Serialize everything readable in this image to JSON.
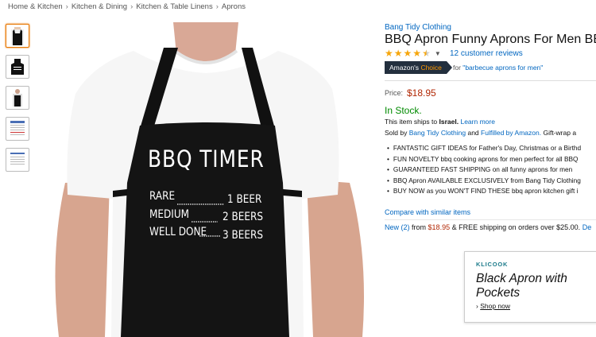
{
  "breadcrumb": {
    "items": [
      "Home & Kitchen",
      "Kitchen & Dining",
      "Kitchen & Table Linens",
      "Aprons"
    ],
    "separator": "›"
  },
  "thumbnails": [
    "apron-front",
    "apron-flat",
    "man-wearing-apron",
    "size-chart",
    "size-chart-2"
  ],
  "apron": {
    "title": "BBQ TIMER",
    "rows": [
      {
        "left": "RARE",
        "right": "1 BEER"
      },
      {
        "left": "MEDIUM",
        "right": "2 BEERS"
      },
      {
        "left": "WELL DONE",
        "right": "3 BEERS"
      }
    ]
  },
  "product": {
    "brand": "Bang Tidy Clothing",
    "title": "BBQ Apron Funny Aprons For Men BBQ T",
    "reviews": "12 customer reviews",
    "rating": 4.5,
    "choice": {
      "label_a": "Amazon's",
      "label_b": "Choice",
      "for": "for",
      "query": "\"barbecue aprons for men\""
    },
    "price_label": "Price:",
    "price": "$18.95",
    "stock": "In Stock.",
    "ships_pre": "This item ships to",
    "ships_country": "Israel.",
    "ships_link": "Learn more",
    "sold_pre": "Sold by",
    "sold_seller": "Bang Tidy Clothing",
    "sold_and": "and",
    "sold_fulfilled": "Fulfilled by Amazon.",
    "sold_tail": "Gift-wrap a",
    "bullets": [
      "FANTASTIC GIFT IDEAS for Father's Day, Christmas or a Birthd",
      "FUN NOVELTY bbq cooking aprons for men perfect for all BBQ",
      "GUARANTEED FAST SHIPPING on all funny aprons for men",
      "BBQ Apron AVAILABLE EXCLUSIVELY from Bang Tidy Clothing",
      "BUY NOW as you WON'T FIND THESE bbq apron kitchen gift i"
    ],
    "compare": "Compare with similar items",
    "new_link": "New (2)",
    "new_from": "from",
    "new_price": "$18.95",
    "new_tail": "& FREE shipping on orders over $25.00.",
    "new_details": "De"
  },
  "ad": {
    "brand": "KLICOOK",
    "title": "Black Apron with Pockets",
    "shop": "Shop now"
  },
  "colors": {
    "link": "#0066c0",
    "price": "#b12704",
    "stock": "#008a00",
    "star": "#f6a60c",
    "choice_bg": "#232f3e",
    "choice_accent": "#ff9900"
  }
}
